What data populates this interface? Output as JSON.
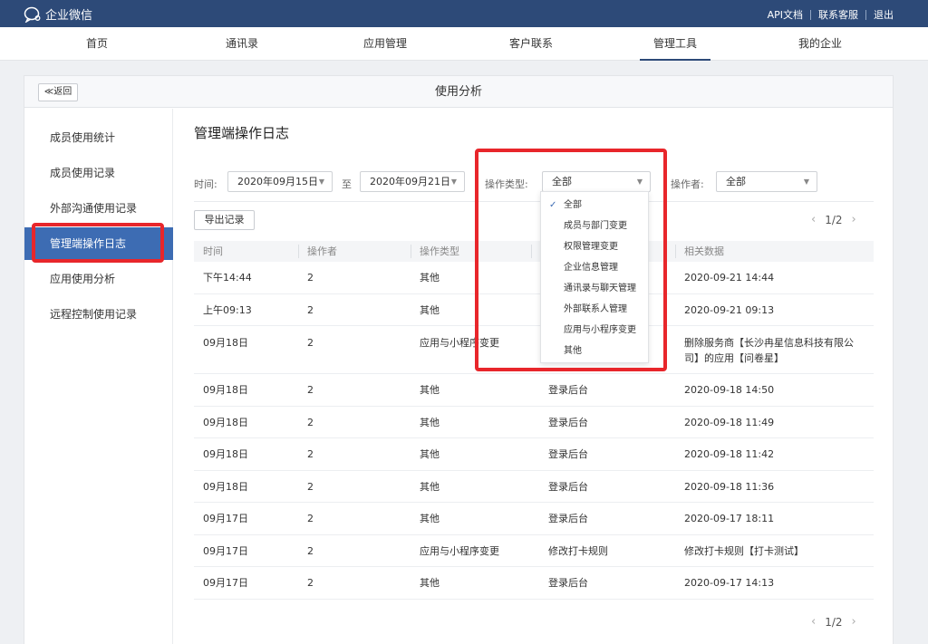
{
  "topbar": {
    "app_name": "企业微信",
    "links": [
      "API文档",
      "联系客服",
      "退出"
    ]
  },
  "nav": {
    "items": [
      "首页",
      "通讯录",
      "应用管理",
      "客户联系",
      "管理工具",
      "我的企业"
    ],
    "active": "管理工具"
  },
  "panel": {
    "back_label": "≪返回",
    "title": "使用分析"
  },
  "sidebar": {
    "items": [
      "成员使用统计",
      "成员使用记录",
      "外部沟通使用记录",
      "管理端操作日志",
      "应用使用分析",
      "远程控制使用记录"
    ],
    "active": "管理端操作日志"
  },
  "content": {
    "title": "管理端操作日志",
    "time_label": "时间:",
    "start_date": "2020年09月15日",
    "to_label": "至",
    "end_date": "2020年09月21日",
    "op_type_label": "操作类型:",
    "op_type_value": "全部",
    "operator_label": "操作者:",
    "operator_value": "全部",
    "export_label": "导出记录",
    "pager": "1/2"
  },
  "table": {
    "headers": [
      "时间",
      "操作者",
      "操作类型",
      "",
      "相关数据"
    ],
    "rows": [
      [
        "下午14:44",
        "2",
        "其他",
        "",
        "2020-09-21 14:44"
      ],
      [
        "上午09:13",
        "2",
        "其他",
        "",
        "2020-09-21 09:13"
      ],
      [
        "09月18日",
        "2",
        "应用与小程序变更",
        "",
        "删除服务商【长沙冉星信息科技有限公",
        "司】的应用【问卷星】"
      ],
      [
        "09月18日",
        "2",
        "其他",
        "登录后台",
        "2020-09-18 14:50"
      ],
      [
        "09月18日",
        "2",
        "其他",
        "登录后台",
        "2020-09-18 11:49"
      ],
      [
        "09月18日",
        "2",
        "其他",
        "登录后台",
        "2020-09-18 11:42"
      ],
      [
        "09月18日",
        "2",
        "其他",
        "登录后台",
        "2020-09-18 11:36"
      ],
      [
        "09月17日",
        "2",
        "其他",
        "登录后台",
        "2020-09-17 18:11"
      ],
      [
        "09月17日",
        "2",
        "应用与小程序变更",
        "修改打卡规则",
        "修改打卡规则【打卡测试】"
      ],
      [
        "09月17日",
        "2",
        "其他",
        "登录后台",
        "2020-09-17 14:13"
      ]
    ]
  },
  "dropdown": {
    "options": [
      "全部",
      "成员与部门变更",
      "权限管理变更",
      "企业信息管理",
      "通讯录与聊天管理",
      "外部联系人管理",
      "应用与小程序变更",
      "其他"
    ],
    "selected": "全部"
  },
  "colors": {
    "topbar": "#2d4a78",
    "sidebar_active": "#3d6cb3",
    "highlight": "#e8262b"
  }
}
